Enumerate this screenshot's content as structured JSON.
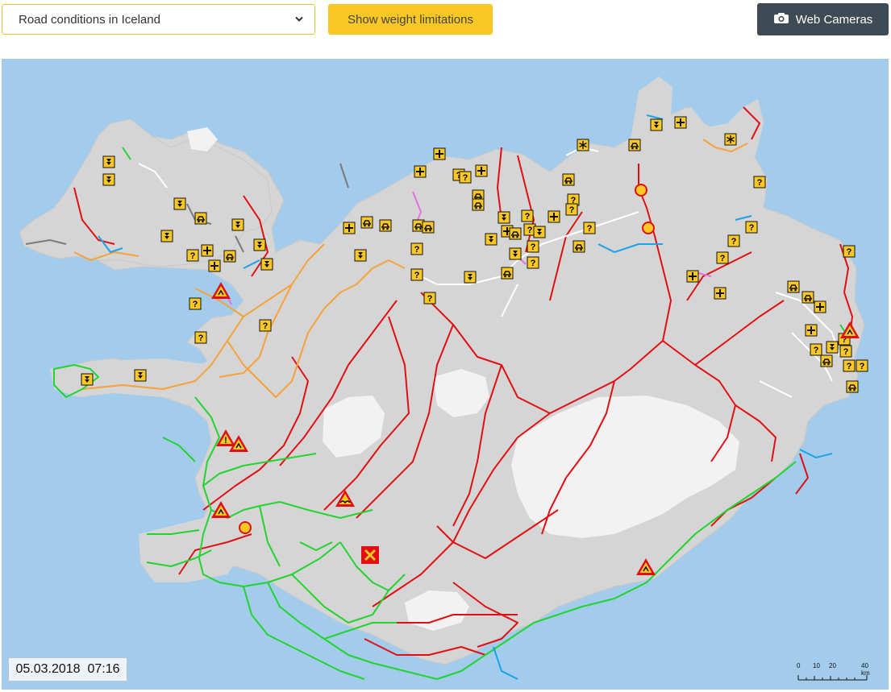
{
  "toolbar": {
    "region_select": "Road conditions in Iceland",
    "weight_button": "Show weight limitations",
    "webcam_button": "Web Cameras"
  },
  "map": {
    "timestamp": "05.03.2018  07:16",
    "scale": {
      "t0": "0",
      "t10": "10",
      "t20": "20",
      "t40": "40 km"
    },
    "colors": {
      "sea": "#a3ccec",
      "land": "#d5d5d5",
      "glacier": "#f2f2f2",
      "road_green": "#22d430",
      "road_red": "#e10f13",
      "road_orange": "#f5a33c",
      "road_blue": "#1aa2ea",
      "road_white": "#ffffff",
      "road_pink": "#e86fe1",
      "road_gray": "#7a7a7a",
      "sign_yellow": "#f9c824"
    }
  }
}
